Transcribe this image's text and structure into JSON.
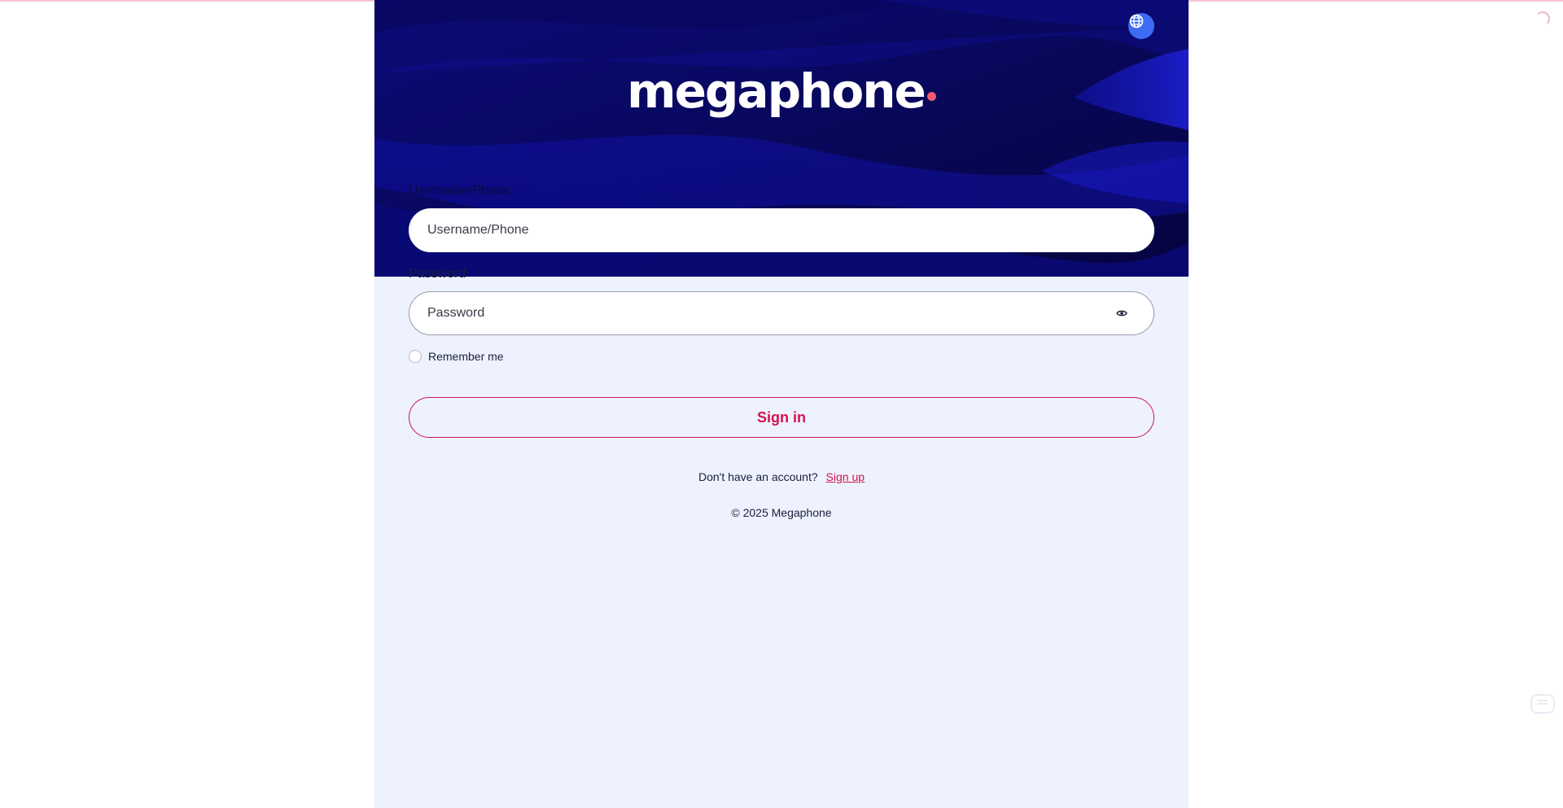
{
  "app": {
    "logo_text": "megaphone",
    "brand_color": "#d4134d",
    "hero_color": "#070656",
    "page_background": "#edf2fe"
  },
  "header": {
    "language_icon": "globe-icon"
  },
  "form": {
    "username": {
      "label": "Username/Phone",
      "placeholder": "Username/Phone",
      "value": ""
    },
    "password": {
      "label": "Password",
      "placeholder": "Password",
      "value": "",
      "toggle_icon": "eye-icon"
    },
    "remember_me": {
      "label": "Remember me",
      "checked": false
    },
    "submit_label": "Sign in"
  },
  "footer": {
    "signup_prompt": "Don't have an account?",
    "signup_link": "Sign up",
    "copyright": "© 2025 Megaphone"
  }
}
